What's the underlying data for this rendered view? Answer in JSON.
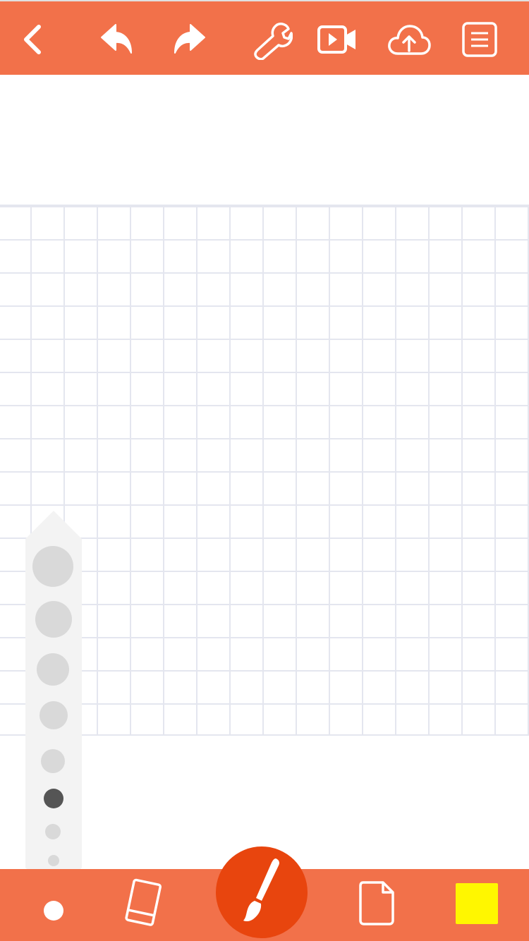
{
  "theme": {
    "accent": "#f2714a",
    "brush_button": "#e8450e",
    "grid_line": "#e4e6ef"
  },
  "toolbar": {
    "items": [
      {
        "icon": "back-chevron-icon"
      },
      {
        "icon": "undo-icon"
      },
      {
        "icon": "redo-icon"
      },
      {
        "icon": "wrench-icon"
      },
      {
        "icon": "video-icon"
      },
      {
        "icon": "cloud-upload-icon"
      },
      {
        "icon": "menu-list-icon"
      }
    ]
  },
  "brush_size_picker": {
    "sizes": [
      "xxl",
      "xl",
      "l",
      "m",
      "s",
      "xs",
      "xxs",
      "xxxs"
    ],
    "selected": "xs"
  },
  "bottom_toolbar": {
    "items": [
      {
        "icon": "current-size-dot"
      },
      {
        "icon": "eraser-icon"
      },
      {
        "icon": "brush-icon"
      },
      {
        "icon": "page-icon"
      },
      {
        "icon": "color-swatch"
      }
    ],
    "current_color": "#fff700"
  }
}
